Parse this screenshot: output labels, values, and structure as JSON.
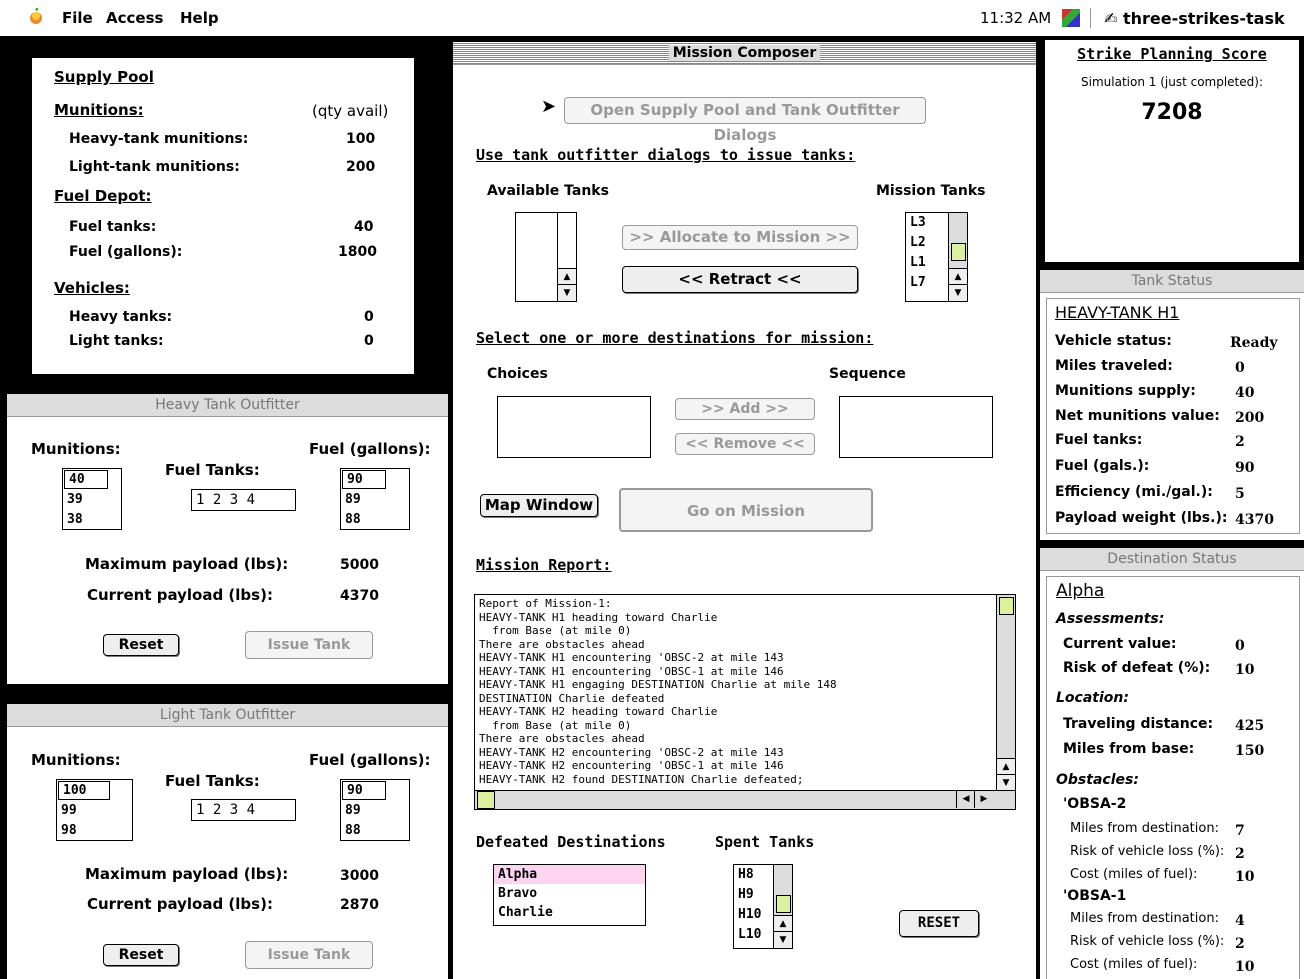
{
  "menubar": {
    "menus": [
      "File",
      "Access",
      "Help"
    ],
    "time": "11:32 AM",
    "app": "three-strikes-task"
  },
  "supply_pool": {
    "title": "Supply Pool",
    "munitions_heading": "Munitions:",
    "qty_label": "(qty avail)",
    "heavy_munitions_label": "Heavy-tank munitions:",
    "heavy_munitions": "100",
    "light_munitions_label": "Light-tank munitions:",
    "light_munitions": "200",
    "fuel_heading": "Fuel Depot:",
    "fuel_tanks_label": "Fuel tanks:",
    "fuel_tanks": "40",
    "fuel_gallons_label": "Fuel (gallons):",
    "fuel_gallons": "1800",
    "vehicles_heading": "Vehicles:",
    "heavy_tanks_label": "Heavy tanks:",
    "heavy_tanks": "0",
    "light_tanks_label": "Light tanks:",
    "light_tanks": "0"
  },
  "heavy_outfitter": {
    "title": "Heavy Tank Outfitter",
    "munitions_label": "Munitions:",
    "munitions": [
      "40",
      "39",
      "38"
    ],
    "fuel_tanks_label": "Fuel Tanks:",
    "fuel_tanks": [
      "1",
      "2",
      "3",
      "4"
    ],
    "fuel_label": "Fuel (gallons):",
    "fuel": [
      "90",
      "89",
      "88"
    ],
    "max_payload_label": "Maximum payload (lbs):",
    "max_payload": "5000",
    "cur_payload_label": "Current payload (lbs):",
    "cur_payload": "4370",
    "reset": "Reset",
    "issue": "Issue Tank"
  },
  "light_outfitter": {
    "title": "Light Tank Outfitter",
    "munitions_label": "Munitions:",
    "munitions": [
      "100",
      "99",
      "98"
    ],
    "fuel_tanks_label": "Fuel Tanks:",
    "fuel_tanks": [
      "1",
      "2",
      "3",
      "4"
    ],
    "fuel_label": "Fuel (gallons):",
    "fuel": [
      "90",
      "89",
      "88"
    ],
    "max_payload_label": "Maximum payload (lbs):",
    "max_payload": "3000",
    "cur_payload_label": "Current payload (lbs):",
    "cur_payload": "2870",
    "reset": "Reset",
    "issue": "Issue Tank"
  },
  "composer": {
    "title": "Mission Composer",
    "open_dialogs": "Open Supply Pool and Tank Outfitter Dialogs",
    "issue_heading": "Use tank outfitter dialogs to issue tanks:",
    "available_label": "Available Tanks",
    "mission_label": "Mission Tanks",
    "allocate": ">> Allocate to Mission >>",
    "retract": "<< Retract <<",
    "mission_tanks": [
      "L3",
      "L2",
      "L1",
      "L7"
    ],
    "dest_heading": "Select one or more destinations for mission:",
    "choices_label": "Choices",
    "sequence_label": "Sequence",
    "add": ">> Add >>",
    "remove": "<< Remove <<",
    "map_window": "Map Window",
    "go": "Go on Mission",
    "report_heading": "Mission Report:",
    "report": [
      "Report of Mission-1:",
      "HEAVY-TANK H1 heading toward Charlie",
      "  from Base (at mile 0)",
      "There are obstacles ahead",
      "HEAVY-TANK H1 encountering 'OBSC-2 at mile 143",
      "HEAVY-TANK H1 encountering 'OBSC-1 at mile 146",
      "HEAVY-TANK H1 engaging DESTINATION Charlie at mile 148",
      "DESTINATION Charlie defeated",
      "HEAVY-TANK H2 heading toward Charlie",
      "  from Base (at mile 0)",
      "There are obstacles ahead",
      "HEAVY-TANK H2 encountering 'OBSC-2 at mile 143",
      "HEAVY-TANK H2 encountering 'OBSC-1 at mile 146",
      "HEAVY-TANK H2 found DESTINATION Charlie defeated;"
    ],
    "defeated_label": "Defeated Destinations",
    "defeated": [
      "Alpha",
      "Bravo",
      "Charlie"
    ],
    "spent_label": "Spent Tanks",
    "spent": [
      "H8",
      "H9",
      "H10",
      "L10"
    ],
    "reset": "RESET"
  },
  "score": {
    "title": "Strike Planning Score",
    "sub": "Simulation 1 (just completed):",
    "value": "7208"
  },
  "tank_status": {
    "title": "Tank Status",
    "name": "HEAVY-TANK H1",
    "rows": [
      {
        "k": "Vehicle status:",
        "v": "Ready"
      },
      {
        "k": "Miles traveled:",
        "v": "0"
      },
      {
        "k": "Munitions supply:",
        "v": "40"
      },
      {
        "k": "Net munitions value:",
        "v": "200"
      },
      {
        "k": "Fuel tanks:",
        "v": "2"
      },
      {
        "k": "Fuel (gals.):",
        "v": "90"
      },
      {
        "k": "Efficiency (mi./gal.):",
        "v": "5"
      },
      {
        "k": "Payload weight (lbs.):",
        "v": "4370"
      }
    ]
  },
  "dest_status": {
    "title": "Destination Status",
    "name": "Alpha",
    "assess_label": "Assessments:",
    "current_value_label": "Current value:",
    "current_value": "0",
    "risk_label": "Risk of defeat (%):",
    "risk": "10",
    "location_label": "Location:",
    "travel_label": "Traveling distance:",
    "travel": "425",
    "miles_base_label": "Miles from base:",
    "miles_base": "150",
    "obstacles_label": "Obstacles:",
    "obstacles": [
      {
        "name": "'OBSA-2",
        "dist": "7",
        "loss": "2",
        "cost": "10"
      },
      {
        "name": "'OBSA-1",
        "dist": "4",
        "loss": "2",
        "cost": "10"
      }
    ],
    "obs_dist_label": "Miles from destination:",
    "obs_loss_label": "Risk of vehicle loss (%):",
    "obs_cost_label": "Cost (miles of fuel):"
  }
}
